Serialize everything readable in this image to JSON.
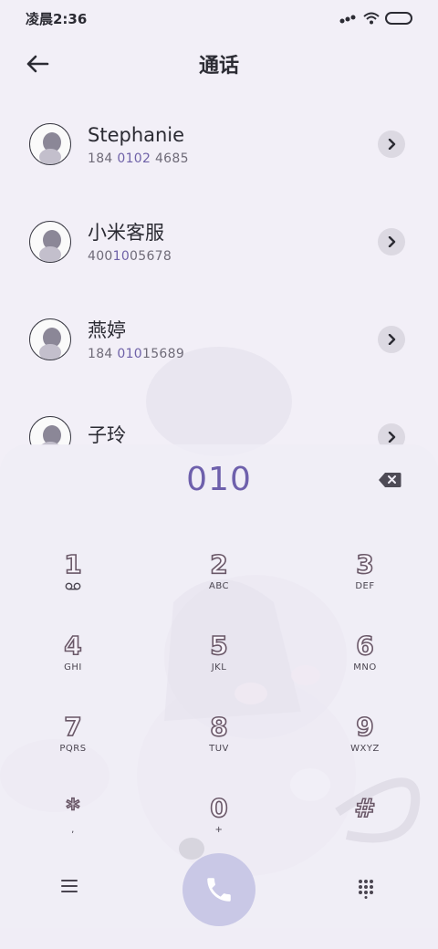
{
  "status_bar": {
    "time": "凌晨2:36"
  },
  "header": {
    "title": "通话"
  },
  "contacts": [
    {
      "name": "Stephanie",
      "number_prefix": "184 ",
      "number_highlight": "0102",
      "number_suffix": " 4685"
    },
    {
      "name": "小米客服",
      "number_prefix": "400",
      "number_highlight": "10",
      "number_suffix": "05678"
    },
    {
      "name": "燕婷",
      "number_prefix": "184 ",
      "number_highlight": "010",
      "number_suffix": "15689"
    },
    {
      "name": "子玲",
      "number_prefix": "",
      "number_highlight": "",
      "number_suffix": ""
    }
  ],
  "dialer": {
    "input": "010"
  },
  "keypad": [
    {
      "digit": "1",
      "letters": ""
    },
    {
      "digit": "2",
      "letters": "ABC"
    },
    {
      "digit": "3",
      "letters": "DEF"
    },
    {
      "digit": "4",
      "letters": "GHI"
    },
    {
      "digit": "5",
      "letters": "JKL"
    },
    {
      "digit": "6",
      "letters": "MNO"
    },
    {
      "digit": "7",
      "letters": "PQRS"
    },
    {
      "digit": "8",
      "letters": "TUV"
    },
    {
      "digit": "9",
      "letters": "WXYZ"
    },
    {
      "digit": "*",
      "letters": ","
    },
    {
      "digit": "0",
      "letters": "+"
    },
    {
      "digit": "#",
      "letters": ""
    }
  ],
  "icons": {
    "back": "arrow-left-icon",
    "row_arrow": "chevron-right-icon",
    "backspace": "backspace-icon",
    "voicemail": "voicemail-icon",
    "menu": "menu-icon",
    "call": "phone-icon",
    "keypad": "keypad-icon"
  },
  "colors": {
    "background": "#f2eff7",
    "accent": "#6e60ac",
    "call_button": "#c9c8e6",
    "arrow_chip": "#dcd9e2"
  }
}
